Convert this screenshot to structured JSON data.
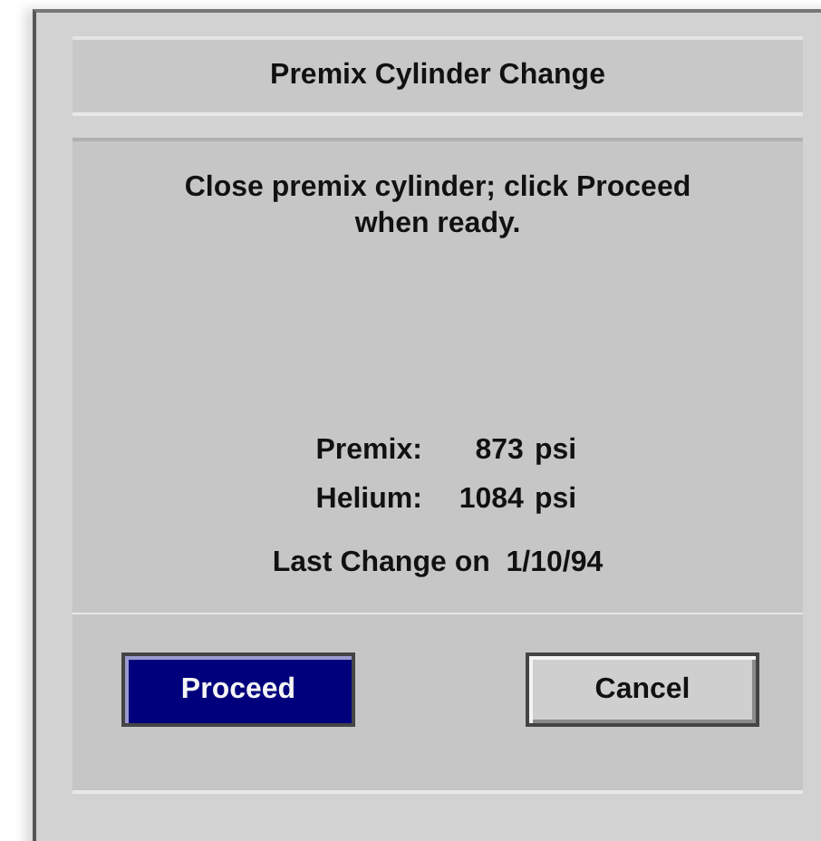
{
  "dialog": {
    "title": "Premix Cylinder Change",
    "message": "Close premix cylinder; click Proceed when ready.",
    "readings": [
      {
        "label": "Premix:",
        "value": "873",
        "unit": "psi"
      },
      {
        "label": "Helium:",
        "value": "1084",
        "unit": "psi"
      }
    ],
    "last_change": "Last Change on  1/10/94",
    "buttons": [
      {
        "label": "Proceed",
        "selected": true
      },
      {
        "label": "Cancel",
        "selected": false
      }
    ]
  }
}
